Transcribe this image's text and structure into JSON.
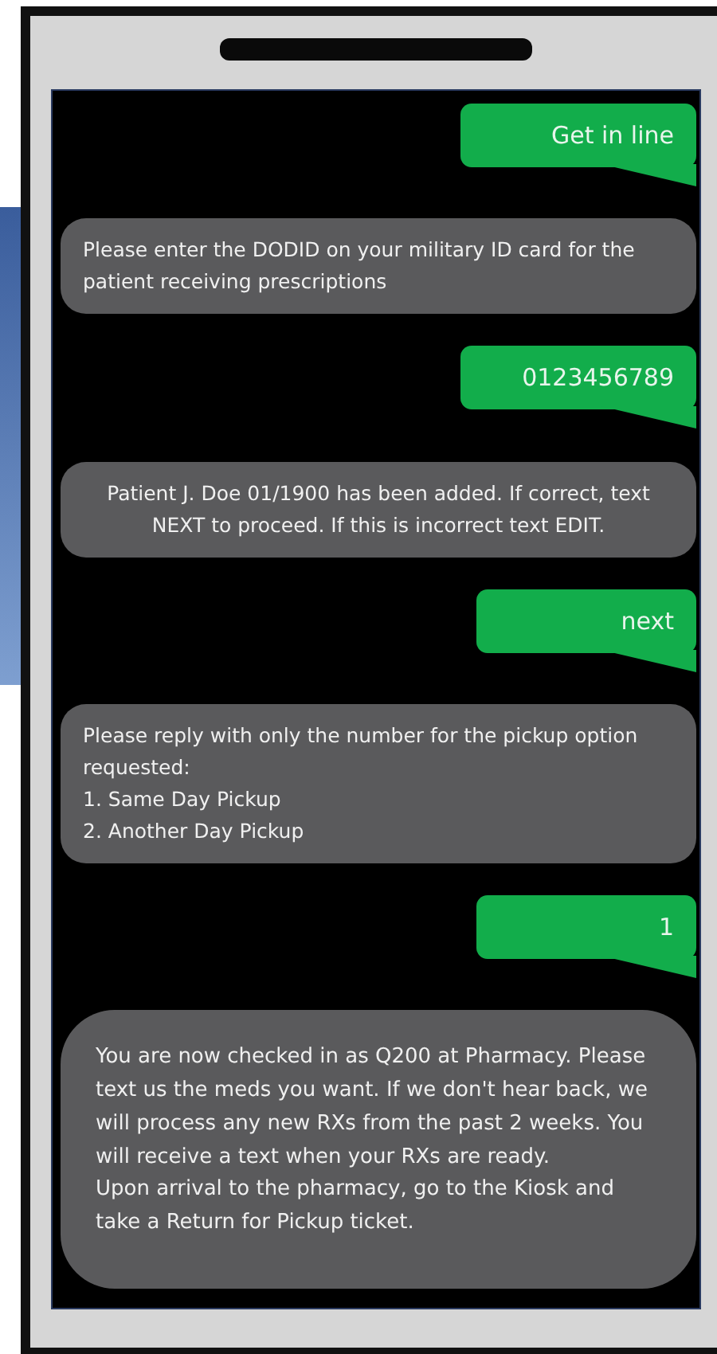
{
  "messages": [
    {
      "kind": "outgoing",
      "text": "Get in line"
    },
    {
      "kind": "incoming",
      "centered": false,
      "text": "Please enter the DODID on your military ID card for the patient receiving prescriptions"
    },
    {
      "kind": "outgoing",
      "text": "0123456789"
    },
    {
      "kind": "incoming",
      "centered": true,
      "text": "Patient J. Doe 01/1900 has been added. If correct, text NEXT to proceed. If this is incorrect text EDIT."
    },
    {
      "kind": "outgoing",
      "text": "next"
    },
    {
      "kind": "incoming",
      "centered": false,
      "text": "Please reply with only the number for the pickup option requested:\n1. Same Day Pickup\n2. Another Day Pickup"
    },
    {
      "kind": "outgoing",
      "text": "1"
    },
    {
      "kind": "incoming",
      "centered": false,
      "text": "You are now checked in as Q200 at Pharmacy. Please text us the meds you want. If we don't hear back, we will process any new RXs from the past 2 weeks. You will receive a text when your RXs are ready.\nUpon arrival to the pharmacy, go to the Kiosk and take a Return for Pickup ticket."
    }
  ]
}
